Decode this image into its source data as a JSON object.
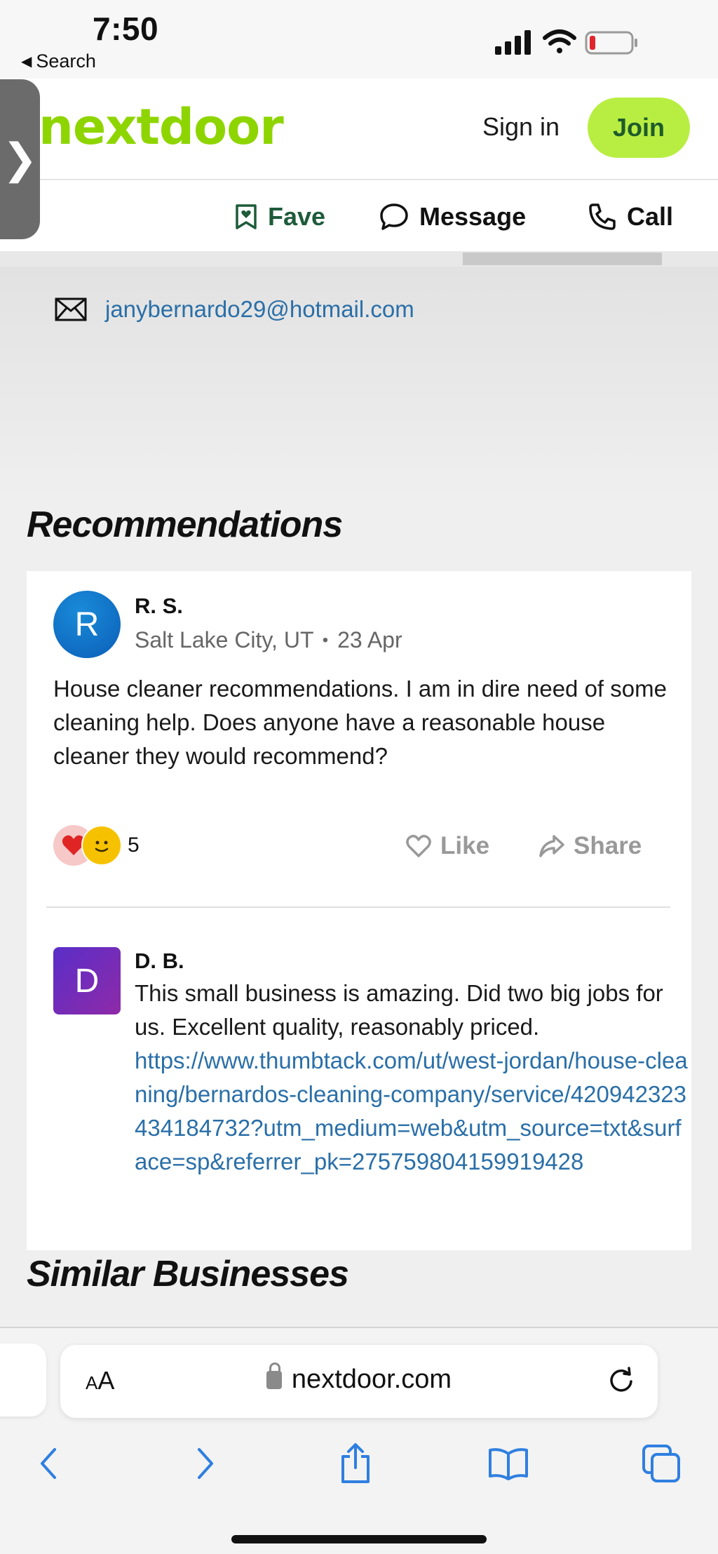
{
  "status_bar": {
    "time": "7:50",
    "back_label": "Search",
    "battery_level": 0.1
  },
  "header": {
    "brand": "nextdoor",
    "sign_in": "Sign in",
    "join": "Join",
    "side_handle": "❯"
  },
  "actions": {
    "fave": "Fave",
    "message": "Message",
    "call": "Call"
  },
  "contact": {
    "email": "janybernardo29@hotmail.com"
  },
  "recommendations": {
    "title": "Recommendations",
    "post": {
      "avatar_letter": "R",
      "author": "R. S.",
      "location": "Salt Lake City, UT",
      "separator": "•",
      "date": "23 Apr",
      "body": "House cleaner recommendations. I am in dire need of some cleaning help. Does anyone have a reasonable house cleaner they would recommend?",
      "reaction_count": "5",
      "like_label": "Like",
      "share_label": "Share"
    },
    "comment": {
      "avatar_letter": "D",
      "author": "D. B.",
      "body": "This small business is amazing. Did two big jobs for us. Excellent quality, reasonably priced.",
      "link": "https://www.thumbtack.com/ut/west-jordan/house-cleaning/bernardos-cleaning-company/service/420942323434184732?utm_medium=web&utm_source=txt&surface=sp&referrer_pk=275759804159919428"
    }
  },
  "similar": {
    "title": "Similar Businesses"
  },
  "safari": {
    "aa_label": "AA",
    "url": "nextdoor.com"
  },
  "colors": {
    "brand_green": "#8ed500",
    "join_bg": "#b8ee42",
    "link_blue": "#2a6fa8",
    "fave_green": "#1e5b3a"
  }
}
